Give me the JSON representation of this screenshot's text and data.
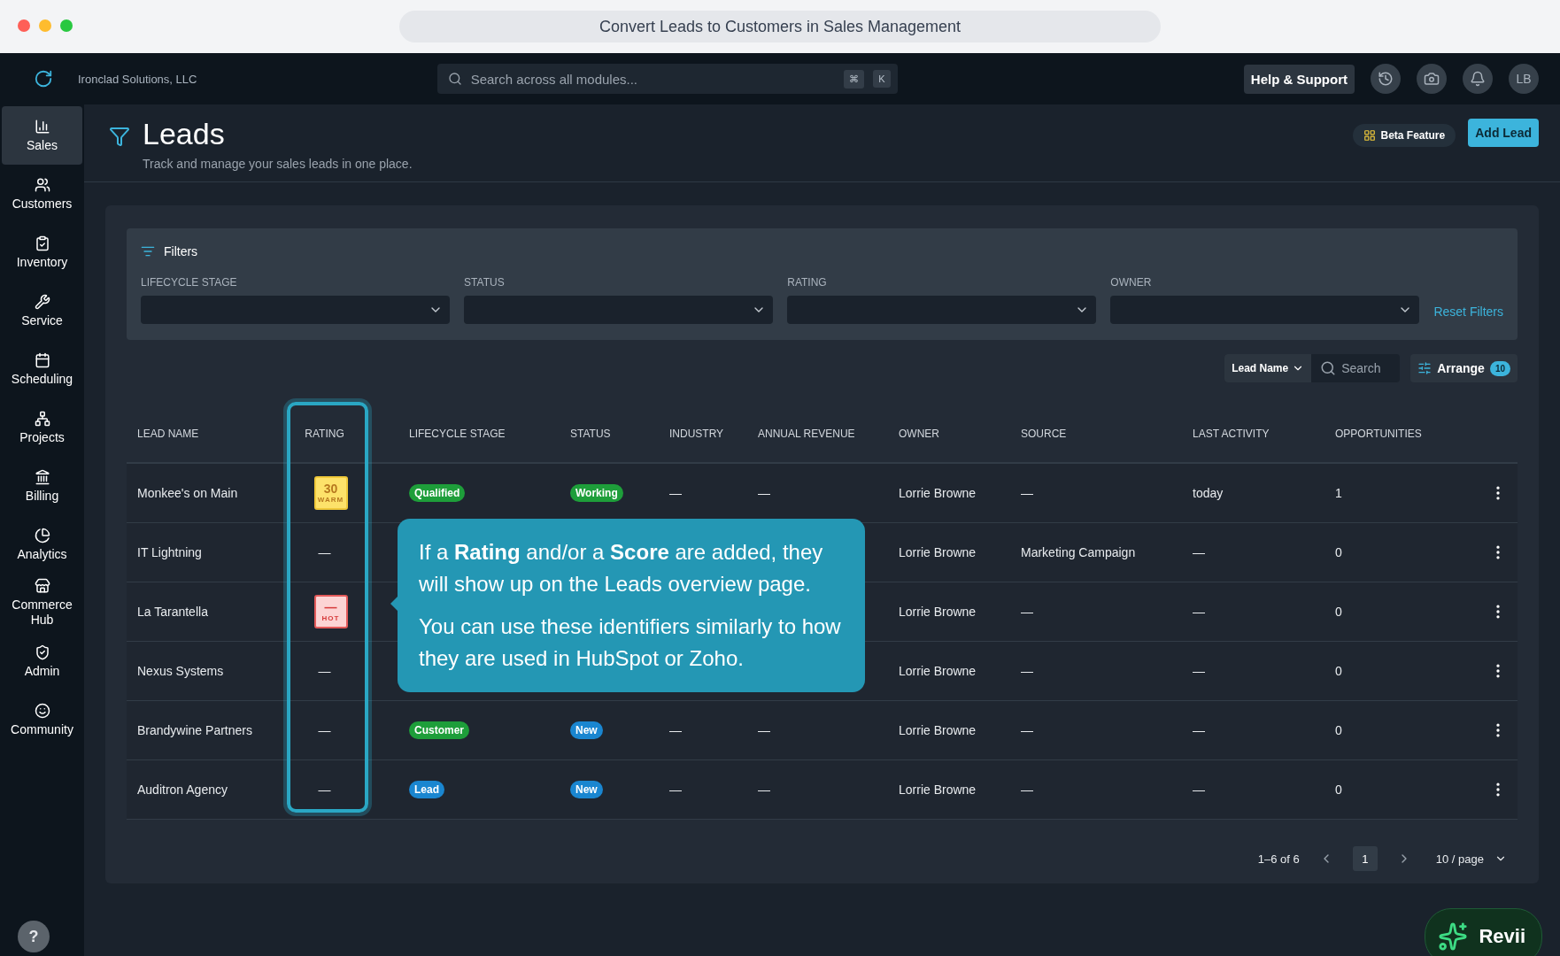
{
  "window": {
    "title": "Convert Leads to Customers in Sales Management"
  },
  "topbar": {
    "company": "Ironclad Solutions, LLC",
    "search": {
      "placeholder": "Search across all modules...",
      "keys": [
        "⌘",
        "K"
      ]
    },
    "help": "Help & Support",
    "avatar": "LB"
  },
  "sidebar": {
    "items": [
      {
        "label": "Sales",
        "selected": true
      },
      {
        "label": "Customers",
        "selected": false
      },
      {
        "label": "Inventory",
        "selected": false
      },
      {
        "label": "Service",
        "selected": false
      },
      {
        "label": "Scheduling",
        "selected": false
      },
      {
        "label": "Projects",
        "selected": false
      },
      {
        "label": "Billing",
        "selected": false
      },
      {
        "label": "Analytics",
        "selected": false
      },
      {
        "label": "Commerce Hub",
        "selected": false
      },
      {
        "label": "Admin",
        "selected": false
      },
      {
        "label": "Community",
        "selected": false
      }
    ],
    "help": "?"
  },
  "header": {
    "title": "Leads",
    "subtitle": "Track and manage your sales leads in one place.",
    "beta": "Beta Feature",
    "add": "Add Lead"
  },
  "filters": {
    "title": "Filters",
    "fields": [
      {
        "label": "LIFECYCLE STAGE"
      },
      {
        "label": "STATUS"
      },
      {
        "label": "RATING"
      },
      {
        "label": "OWNER"
      }
    ],
    "reset": "Reset Filters"
  },
  "toolbar": {
    "field": "Lead Name",
    "search_placeholder": "Search",
    "arrange": "Arrange",
    "arrange_count": "10"
  },
  "table": {
    "columns": [
      "LEAD NAME",
      "RATING",
      "LIFECYCLE STAGE",
      "STATUS",
      "INDUSTRY",
      "ANNUAL REVENUE",
      "OWNER",
      "SOURCE",
      "LAST ACTIVITY",
      "OPPORTUNITIES"
    ],
    "rows": [
      {
        "name": "Monkee's on Main",
        "rating": {
          "kind": "warm",
          "score": "30",
          "label": "WARM"
        },
        "stage": {
          "text": "Qualified",
          "color": "#1e9e3a"
        },
        "status": {
          "text": "Working",
          "color": "#1e9e3a"
        },
        "industry": "—",
        "revenue": "—",
        "owner": "Lorrie Browne",
        "source": "—",
        "last_activity": "today",
        "opportunities": "1"
      },
      {
        "name": "IT Lightning",
        "rating": {
          "kind": "none",
          "score": "—"
        },
        "owner": "Lorrie Browne",
        "source": "Marketing Campaign",
        "last_activity": "—",
        "opportunities": "0"
      },
      {
        "name": "La Tarantella",
        "rating": {
          "kind": "hot",
          "score": "—",
          "label": "HOT"
        },
        "owner": "Lorrie Browne",
        "source": "—",
        "last_activity": "—",
        "opportunities": "0"
      },
      {
        "name": "Nexus Systems",
        "rating": {
          "kind": "none",
          "score": "—"
        },
        "owner": "Lorrie Browne",
        "source": "—",
        "last_activity": "—",
        "opportunities": "0"
      },
      {
        "name": "Brandywine Partners",
        "rating": {
          "kind": "none",
          "score": "—"
        },
        "stage": {
          "text": "Customer",
          "color": "#1e9e3a"
        },
        "status": {
          "text": "New",
          "color": "#1a86d0"
        },
        "industry": "—",
        "revenue": "—",
        "owner": "Lorrie Browne",
        "source": "—",
        "last_activity": "—",
        "opportunities": "0"
      },
      {
        "name": "Auditron Agency",
        "rating": {
          "kind": "none",
          "score": "—"
        },
        "stage": {
          "text": "Lead",
          "color": "#1a86d0"
        },
        "status": {
          "text": "New",
          "color": "#1a86d0"
        },
        "industry": "—",
        "revenue": "—",
        "owner": "Lorrie Browne",
        "source": "—",
        "last_activity": "—",
        "opportunities": "0"
      }
    ]
  },
  "pagination": {
    "range": "1–6 of 6",
    "pages": [
      {
        "label": "1",
        "selected": true
      }
    ],
    "per_page": "10 / page"
  },
  "tooltip": {
    "paragraphs": [
      "If a **Rating** and/or a **Score** are added, they will show up on the Leads overview page.",
      "You can use these identifiers similarly to how they are used in HubSpot or Zoho."
    ]
  },
  "assistant": {
    "label": "Revii"
  }
}
